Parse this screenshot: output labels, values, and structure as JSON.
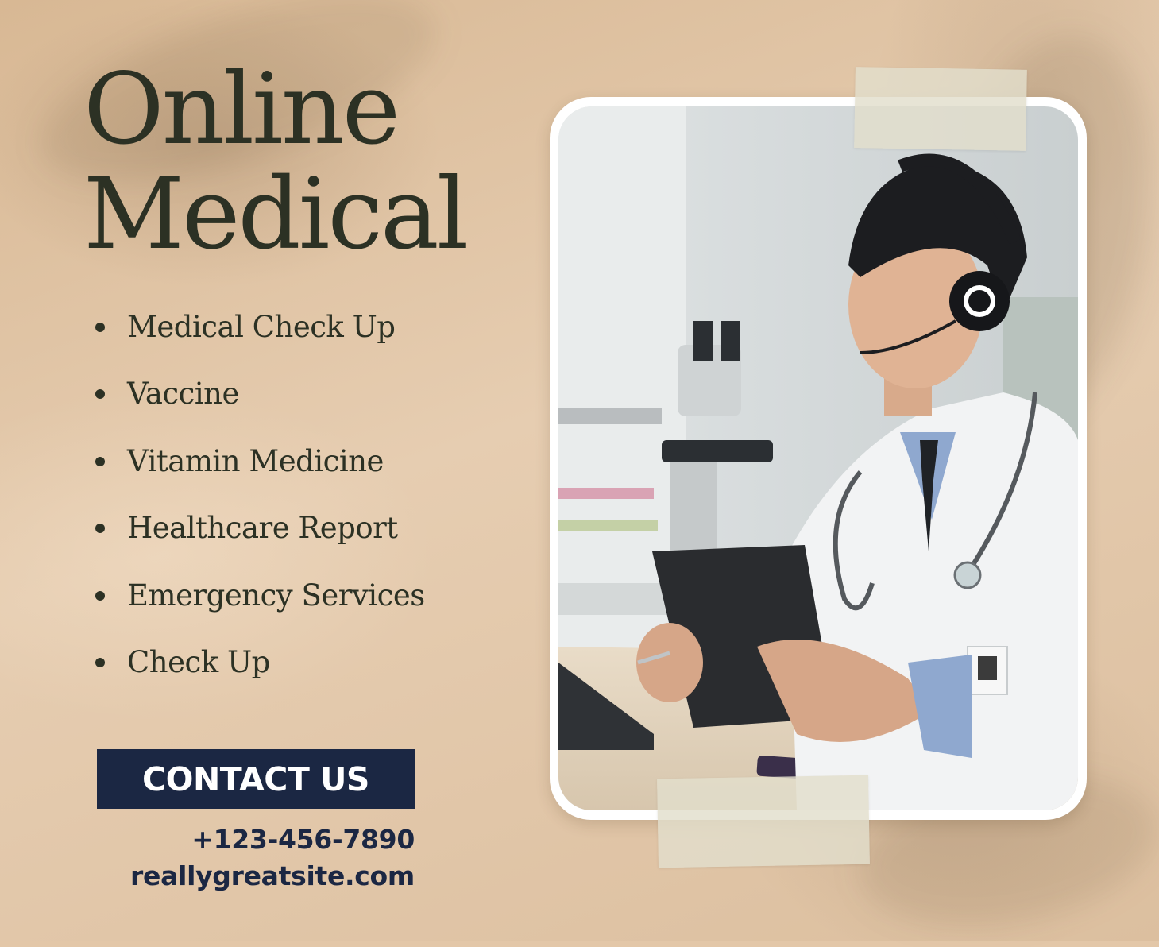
{
  "headline": {
    "line1": "Online",
    "line2": "Medical"
  },
  "services": [
    "Medical Check Up",
    "Vaccine",
    "Vitamin Medicine",
    "Healthcare Report",
    "Emergency Services",
    "Check Up"
  ],
  "contact": {
    "button_label": "CONTACT US",
    "phone": "+123-456-7890",
    "website": "reallygreatsite.com"
  },
  "colors": {
    "background": "#e3c7a8",
    "text_dark_green": "#2c3124",
    "navy": "#1b2743"
  }
}
